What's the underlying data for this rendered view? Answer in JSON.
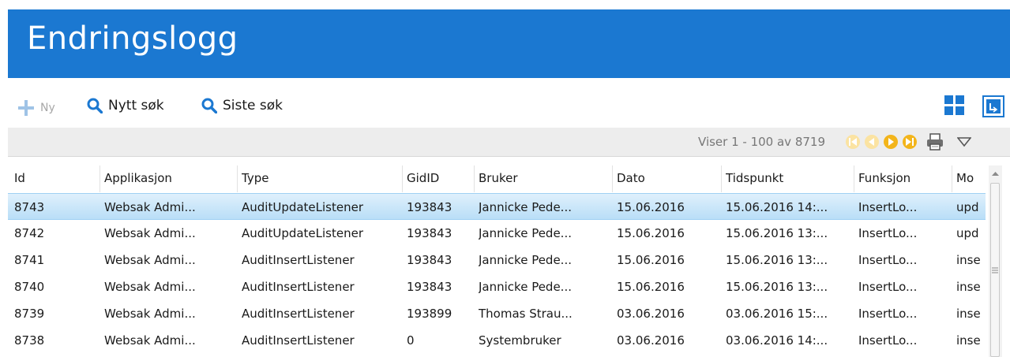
{
  "header": {
    "title": "Endringslogg",
    "accent": "#1b78d1"
  },
  "toolbar": {
    "new_label": "Ny",
    "new_search_label": "Nytt søk",
    "last_search_label": "Siste søk"
  },
  "pager": {
    "text": "Viser 1 - 100 av 8719"
  },
  "grid": {
    "columns": [
      "Id",
      "Applikasjon",
      "Type",
      "GidID",
      "Bruker",
      "Dato",
      "Tidspunkt",
      "Funksjon",
      "Mo"
    ],
    "rows": [
      [
        "8743",
        "Websak Admi...",
        "AuditUpdateListener",
        "193843",
        "Jannicke  Pede...",
        "15.06.2016",
        "15.06.2016 14:...",
        "InsertLo...",
        "upd"
      ],
      [
        "8742",
        "Websak Admi...",
        "AuditUpdateListener",
        "193843",
        "Jannicke  Pede...",
        "15.06.2016",
        "15.06.2016 13:...",
        "InsertLo...",
        "upd"
      ],
      [
        "8741",
        "Websak Admi...",
        "AuditInsertListener",
        "193843",
        "Jannicke  Pede...",
        "15.06.2016",
        "15.06.2016 13:...",
        "InsertLo...",
        "inse"
      ],
      [
        "8740",
        "Websak Admi...",
        "AuditInsertListener",
        "193843",
        "Jannicke  Pede...",
        "15.06.2016",
        "15.06.2016 13:...",
        "InsertLo...",
        "inse"
      ],
      [
        "8739",
        "Websak Admi...",
        "AuditInsertListener",
        "193899",
        "Thomas Strau...",
        "03.06.2016",
        "03.06.2016 15:...",
        "InsertLo...",
        "inse"
      ],
      [
        "8738",
        "Websak Admi...",
        "AuditInsertListener",
        "0",
        "Systembruker",
        "03.06.2016",
        "03.06.2016 14:...",
        "InsertLo...",
        "inse"
      ]
    ],
    "selected_row": 0
  }
}
